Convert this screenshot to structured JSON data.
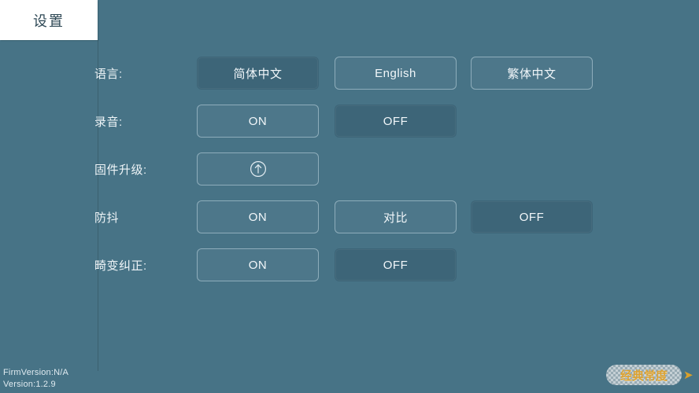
{
  "window": {
    "background_color": "#477386",
    "selected_color": "#3d6578",
    "text_color": "#f2f7fa"
  },
  "tabs": [
    {
      "label": "设置",
      "active": true
    }
  ],
  "settings": {
    "rows": [
      {
        "label": "语言:",
        "name": "language",
        "options": [
          {
            "label": "简体中文",
            "selected": true,
            "type": "text"
          },
          {
            "label": "English",
            "selected": false,
            "type": "text"
          },
          {
            "label": "繁体中文",
            "selected": false,
            "type": "text"
          }
        ]
      },
      {
        "label": "录音:",
        "name": "recording",
        "options": [
          {
            "label": "ON",
            "selected": false,
            "type": "text"
          },
          {
            "label": "OFF",
            "selected": true,
            "type": "text"
          }
        ]
      },
      {
        "label": "固件升级:",
        "name": "firmware-upgrade",
        "options": [
          {
            "label": "",
            "selected": false,
            "type": "icon",
            "icon": "circle-arrow-up-icon"
          }
        ]
      },
      {
        "label": "防抖",
        "name": "anti-shake",
        "options": [
          {
            "label": "ON",
            "selected": false,
            "type": "text"
          },
          {
            "label": "对比",
            "selected": false,
            "type": "text"
          },
          {
            "label": "OFF",
            "selected": true,
            "type": "text"
          }
        ]
      },
      {
        "label": "畸变纠正:",
        "name": "distortion-correction",
        "options": [
          {
            "label": "ON",
            "selected": false,
            "type": "text"
          },
          {
            "label": "OFF",
            "selected": true,
            "type": "text"
          }
        ]
      }
    ]
  },
  "footer": {
    "firmware_version": "FirmVersion:N/A",
    "app_version": "Version:1.2.9"
  },
  "watermark": {
    "text": "经典常度",
    "arrow": "➤",
    "color": "#e9a72c"
  }
}
